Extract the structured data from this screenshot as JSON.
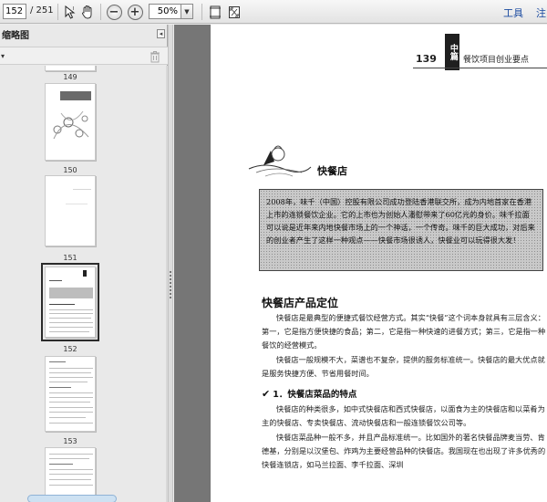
{
  "toolbar": {
    "current_page": "152",
    "total_pages": "/ 251",
    "zoom_value": "50%",
    "tools_label": "工具",
    "comment_label": "注"
  },
  "sidebar": {
    "title": "缩略图",
    "thumbnails": [
      {
        "label": "149"
      },
      {
        "label": "150"
      },
      {
        "label": "151"
      },
      {
        "label": "152",
        "selected": true
      },
      {
        "label": "153"
      }
    ]
  },
  "document": {
    "header_page_number": "139",
    "header_tab_text": "中篇",
    "header_title": "餐饮项目创业要点",
    "section_title": "快餐店",
    "box_text": "2008年，味千（中国）控股有限公司成功登陆香港联交所，成为内地首家在香港上市的连锁餐饮企业。它的上市也为创始人潘慰带来了60亿元的身价。味千拉面可以说是近年来内地快餐市场上的一个神话，一个传奇。味千的巨大成功，对后来的创业者产生了这样一种观点——快餐市场很诱人，快餐业可以玩得很大发！",
    "heading1": "快餐店产品定位",
    "paragraph1": "快餐店是最典型的便捷式餐饮经营方式。其实“快餐”这个词本身就具有三层含义：第一，它是指方便快捷的食品；第二，它是指一种快速的进餐方式；第三，它是指一种餐饮的经营模式。",
    "paragraph2": "快餐店一般规模不大，菜谱也不复杂，提供的服务标准统一。快餐店的最大优点就是服务快捷方便、节省用餐时间。",
    "heading2": "1．快餐店菜品的特点",
    "paragraph3": "快餐店的种类很多，如中式快餐店和西式快餐店，以面食为主的快餐店和以菜肴为主的快餐店、专卖快餐店、流动快餐店和一般连锁餐饮公司等。",
    "paragraph4": "快餐店菜品种一般不多，并且产品标准统一。比如国外的著名快餐品牌麦当劳、肯德基，分别是以汉堡包、炸鸡为主要经营品种的快餐店。我国现在也出现了许多优秀的快餐连锁店，如马兰拉面、李千拉面、深圳"
  }
}
